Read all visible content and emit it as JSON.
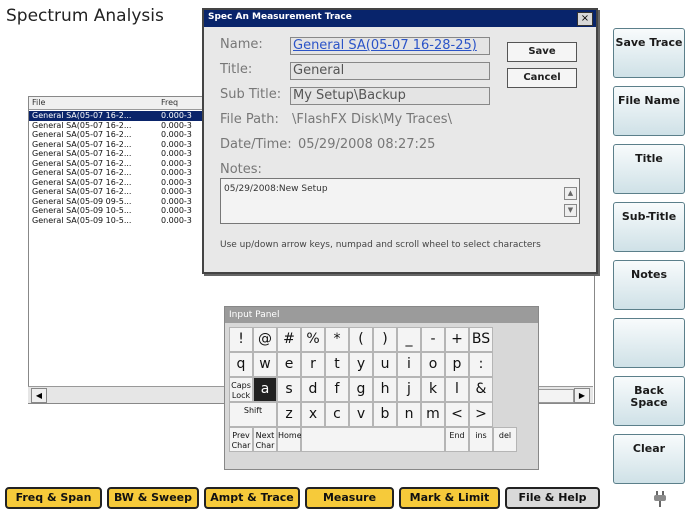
{
  "app_title": "Spectrum Analysis",
  "file_list": {
    "columns": [
      "File",
      "Freq"
    ],
    "rows": [
      [
        "General SA(05-07 16-2...",
        "0.000-3"
      ],
      [
        "General SA(05-07 16-2...",
        "0.000-3"
      ],
      [
        "General SA(05-07 16-2...",
        "0.000-3"
      ],
      [
        "General SA(05-07 16-2...",
        "0.000-3"
      ],
      [
        "General SA(05-07 16-2...",
        "0.000-3"
      ],
      [
        "General SA(05-07 16-2...",
        "0.000-3"
      ],
      [
        "General SA(05-07 16-2...",
        "0.000-3"
      ],
      [
        "General SA(05-07 16-2...",
        "0.000-3"
      ],
      [
        "General SA(05-07 16-2...",
        "0.000-3"
      ],
      [
        "General SA(05-09 09-5...",
        "0.000-3"
      ],
      [
        "General SA(05-09 10-5...",
        "0.000-3"
      ],
      [
        "General SA(05-09 10-5...",
        "0.000-3"
      ]
    ],
    "selected_row": 0
  },
  "dialog": {
    "title": "Spec An Measurement Trace",
    "close": "×",
    "name_label": "Name:",
    "name_value": "General SA(05-07 16-28-25)",
    "title_label": "Title:",
    "title_value": "General",
    "subtitle_label": "Sub Title:",
    "subtitle_value": "My Setup\\Backup",
    "filepath_label": "File Path:",
    "filepath_value": "\\FlashFX Disk\\My Traces\\",
    "datetime_label": "Date/Time:",
    "datetime_value": "05/29/2008 08:27:25",
    "notes_label": "Notes:",
    "notes_value": "05/29/2008:New Setup",
    "save_label": "Save",
    "cancel_label": "Cancel",
    "hint": "Use up/down arrow keys, numpad and scroll wheel to select characters"
  },
  "input_panel": {
    "title": "Input Panel",
    "rows": [
      [
        "!",
        "@",
        "#",
        "%",
        "*",
        "(",
        ")",
        "_",
        "-",
        "+",
        "BS"
      ],
      [
        "q",
        "w",
        "e",
        "r",
        "t",
        "y",
        "u",
        "i",
        "o",
        "p",
        ":"
      ],
      [
        "Caps Lock",
        "a",
        "s",
        "d",
        "f",
        "g",
        "h",
        "j",
        "k",
        "l",
        "&"
      ],
      [
        "Shift",
        "z",
        "x",
        "c",
        "v",
        "b",
        "n",
        "m",
        "<",
        ">"
      ],
      [
        "Prev Char",
        "Next Char",
        "Home",
        "End",
        "ins",
        "del"
      ]
    ],
    "selected_key": "a"
  },
  "softkeys": [
    "Save Trace",
    "File Name",
    "Title",
    "Sub-Title",
    "Notes",
    "",
    "Back Space",
    "Clear"
  ],
  "tabs": [
    "Freq & Span",
    "BW & Sweep",
    "Ampt & Trace",
    "Measure",
    "Mark & Limit",
    "File & Help"
  ],
  "active_tab": "File & Help",
  "icons": {
    "close": "close-icon",
    "scroll_left": "arrow-left-icon",
    "scroll_right": "arrow-right-icon",
    "scroll_up": "arrow-up-icon",
    "scroll_down": "arrow-down-icon",
    "plug": "plug-icon"
  },
  "colors": {
    "dialog_title_bar": "#08246b",
    "tab_yellow": "#f6ca3a",
    "softkey_top": "#f8fbfc",
    "softkey_bottom": "#cfe1e7",
    "selected_row": "#0a246a"
  }
}
